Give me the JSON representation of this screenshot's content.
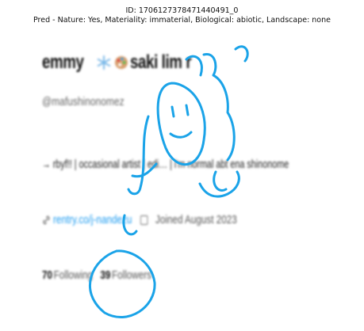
{
  "header": {
    "line1": "ID: 1706127378471440491_0",
    "line2": "Pred - Nature: Yes, Materiality: immaterial, Biological: abiotic, Landscape: none"
  },
  "profile": {
    "display_name_part1": "emmy",
    "display_name_part2": "saki lim r",
    "handle": "@mafushinonomez",
    "bio": "→ rbyf!! | occasional artist | edi… | i'm normal abt ena shinonome",
    "link": "rentry.co/j-nandezu",
    "joined": "Joined August 2023",
    "following_count": "70",
    "following_label": "Following",
    "followers_count": "39",
    "followers_label": "Followers"
  },
  "icons": {
    "snowflake": "snowflake-icon",
    "palette": "palette-icon",
    "link": "link-icon",
    "calendar": "calendar-icon"
  },
  "colors": {
    "scribble": "#1aa3e8",
    "link": "#1d9bf0"
  }
}
